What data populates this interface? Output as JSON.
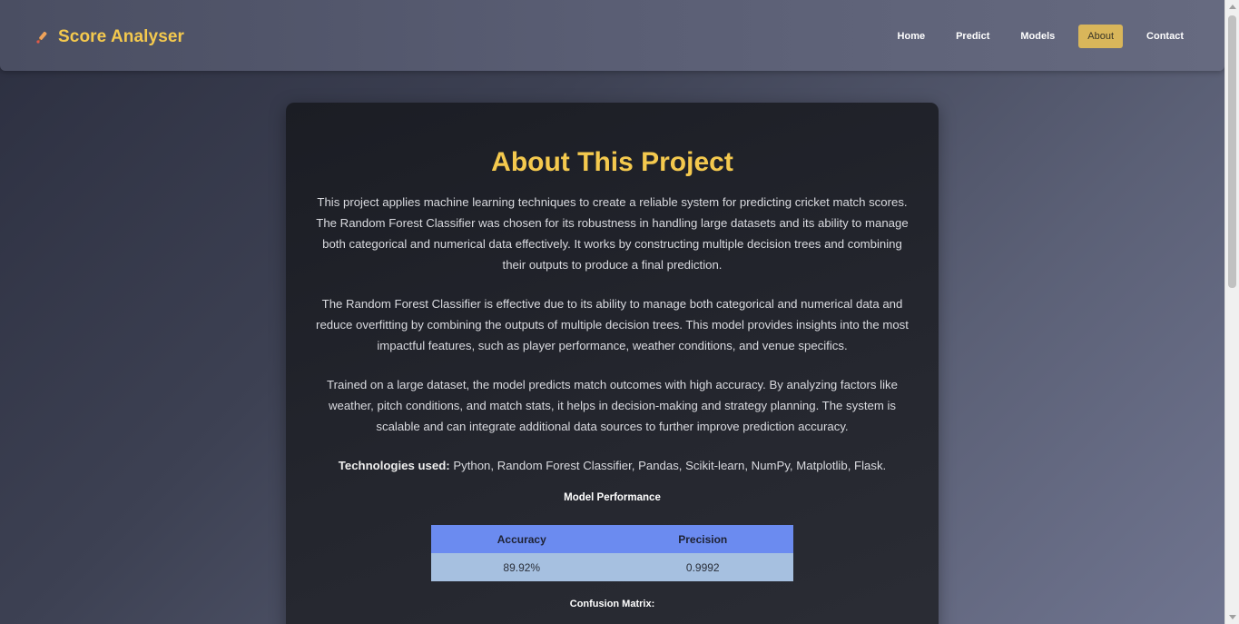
{
  "navbar": {
    "brand_name": "Score Analyser",
    "brand_icon": "cricket-bat-icon",
    "items": [
      {
        "label": "Home",
        "active": false
      },
      {
        "label": "Predict",
        "active": false
      },
      {
        "label": "Models",
        "active": false
      },
      {
        "label": "About",
        "active": true
      },
      {
        "label": "Contact",
        "active": false
      }
    ]
  },
  "colors": {
    "accent": "#f4c94e",
    "active_nav": "#d9b65a",
    "table_header": "#6b8bf0",
    "table_cell": "#a6c0e0"
  },
  "main": {
    "title": "About This Project",
    "paragraphs": [
      "This project applies machine learning techniques to create a reliable system for predicting cricket match scores. The Random Forest Classifier was chosen for its robustness in handling large datasets and its ability to manage both categorical and numerical data effectively. It works by constructing multiple decision trees and combining their outputs to produce a final prediction.",
      "The Random Forest Classifier is effective due to its ability to manage both categorical and numerical data and reduce overfitting by combining the outputs of multiple decision trees. This model provides insights into the most impactful features, such as player performance, weather conditions, and venue specifics.",
      "Trained on a large dataset, the model predicts match outcomes with high accuracy. By analyzing factors like weather, pitch conditions, and match stats, it helps in decision-making and strategy planning. The system is scalable and can integrate additional data sources to further improve prediction accuracy."
    ],
    "technologies_label": "Technologies used:",
    "technologies_value": " Python, Random Forest Classifier, Pandas, Scikit-learn, NumPy, Matplotlib, Flask.",
    "performance_title": "Model Performance",
    "performance_table": {
      "headers": [
        "Accuracy",
        "Precision"
      ],
      "rows": [
        [
          "89.92%",
          "0.9992"
        ]
      ]
    },
    "confusion_title": "Confusion Matrix:"
  }
}
